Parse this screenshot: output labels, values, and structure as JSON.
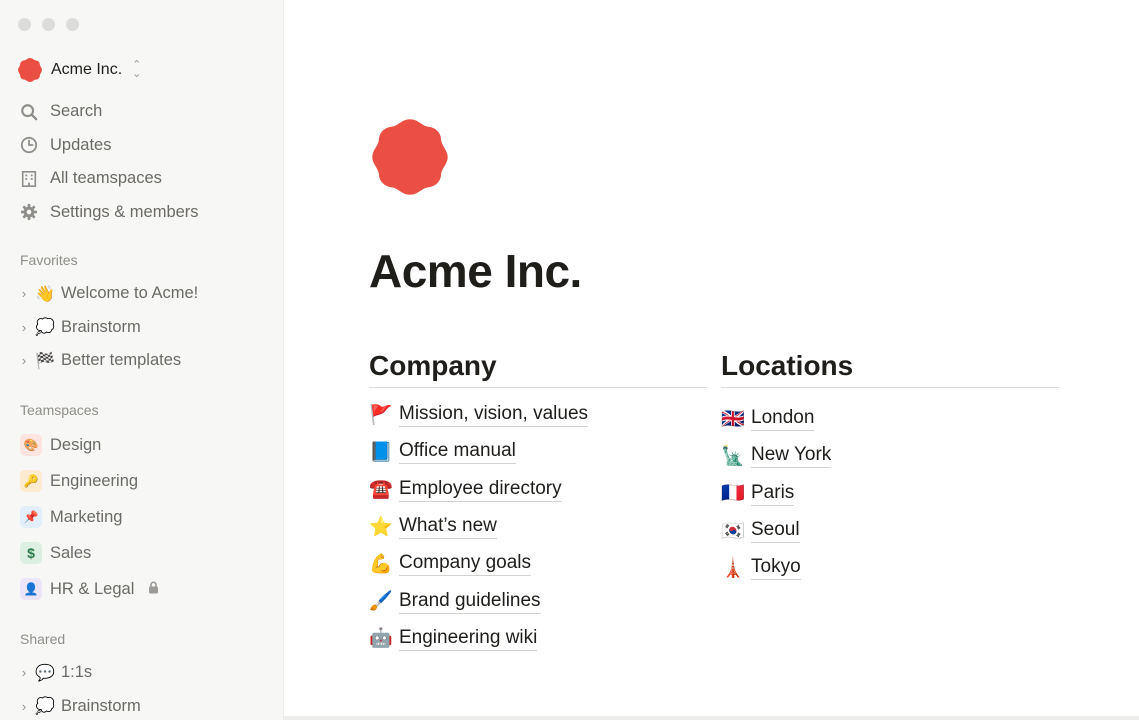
{
  "workspace": {
    "name": "Acme Inc.",
    "brand_color": "#eb4f44"
  },
  "nav": [
    {
      "label": "Search",
      "icon": "search-icon"
    },
    {
      "label": "Updates",
      "icon": "clock-icon"
    },
    {
      "label": "All teamspaces",
      "icon": "building-icon"
    },
    {
      "label": "Settings & members",
      "icon": "gear-icon"
    }
  ],
  "favorites": {
    "label": "Favorites",
    "items": [
      {
        "emoji": "👋",
        "label": "Welcome to Acme!"
      },
      {
        "emoji": "💭",
        "label": "Brainstorm"
      },
      {
        "emoji": "🏁",
        "label": "Better templates"
      }
    ]
  },
  "teamspaces": {
    "label": "Teamspaces",
    "items": [
      {
        "emoji": "🎨",
        "label": "Design",
        "bg": "#fde4e1"
      },
      {
        "emoji": "🔑",
        "label": "Engineering",
        "bg": "#fcebcf"
      },
      {
        "emoji": "📌",
        "label": "Marketing",
        "bg": "#e3eefb"
      },
      {
        "emoji": "$",
        "label": "Sales",
        "bg": "#dcefe2"
      },
      {
        "emoji": "👤",
        "label": "HR & Legal",
        "bg": "#ece4f7",
        "locked": true
      }
    ]
  },
  "shared": {
    "label": "Shared",
    "items": [
      {
        "emoji": "💬",
        "label": "1:1s"
      },
      {
        "emoji": "💭",
        "label": "Brainstorm"
      }
    ]
  },
  "page": {
    "title": "Acme Inc.",
    "company": {
      "heading": "Company",
      "links": [
        {
          "emoji": "🚩",
          "label": "Mission, vision, values"
        },
        {
          "emoji": "📘",
          "label": "Office manual"
        },
        {
          "emoji": "☎️",
          "label": "Employee directory"
        },
        {
          "emoji": "⭐",
          "label": "What’s new"
        },
        {
          "emoji": "💪",
          "label": "Company goals"
        },
        {
          "emoji": "🖌️",
          "label": "Brand guidelines"
        },
        {
          "emoji": "🤖",
          "label": "Engineering wiki"
        }
      ]
    },
    "locations": {
      "heading": "Locations",
      "links": [
        {
          "emoji": "🇬🇧",
          "label": "London"
        },
        {
          "emoji": "🗽",
          "label": "New York"
        },
        {
          "emoji": "🇫🇷",
          "label": "Paris"
        },
        {
          "emoji": "🇰🇷",
          "label": "Seoul"
        },
        {
          "emoji": "🗼",
          "label": "Tokyo"
        }
      ]
    }
  }
}
